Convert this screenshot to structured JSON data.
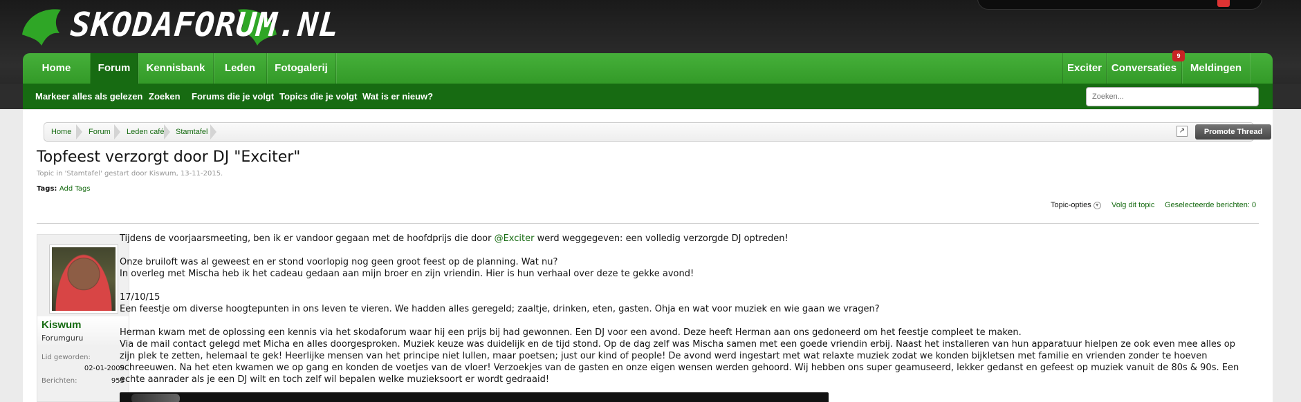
{
  "site": {
    "logo_text": "SKODAFORUM.NL"
  },
  "nav": {
    "tabs": [
      "Home",
      "Forum",
      "Kennisbank",
      "Leden",
      "Fotogalerij"
    ],
    "right_tabs": [
      "Exciter",
      "Conversaties",
      "Meldingen"
    ],
    "conversations_badge": "9",
    "sub_links": [
      "Markeer alles als gelezen",
      "Zoeken",
      "Forums die je volgt",
      "Topics die je volgt",
      "Wat is er nieuw?"
    ],
    "search_placeholder": "Zoeken..."
  },
  "breadcrumb": [
    "Home",
    "Forum",
    "Leden café",
    "Stamtafel"
  ],
  "promote_label": "Promote Thread",
  "thread": {
    "title": "Topfeest verzorgt door DJ \"Exciter\"",
    "meta": "Topic in 'Stamtafel' gestart door Kiswum, 13-11-2015.",
    "tags_label": "Tags:",
    "add_tags": "Add Tags"
  },
  "tools": {
    "options": "Topic-opties",
    "follow": "Volg dit topic",
    "selected": "Geselecteerde berichten: 0"
  },
  "user": {
    "name": "Kiswum",
    "title": "Forumguru",
    "joined_label": "Lid geworden:",
    "joined_value": "02-01-2009",
    "posts_label": "Berichten:",
    "posts_value": "953"
  },
  "post": {
    "p1_pre": "Tijdens de voorjaarsmeeting, ben ik er vandoor gegaan met de hoofdprijs die door ",
    "p1_mention": "@Exciter",
    "p1_post": " werd weggegeven: een volledig verzorgde DJ optreden!",
    "p2_line1": "Onze bruiloft was al geweest en er stond voorlopig nog geen groot feest op de planning. Wat nu?",
    "p2_line2": "In overleg met Mischa heb ik het cadeau gedaan aan mijn broer en zijn vriendin. Hier is hun verhaal over deze te gekke avond!",
    "p3_line1": "17/10/15",
    "p3_line2": "Een feestje om diverse hoogtepunten in ons leven te vieren. We hadden alles geregeld; zaaltje, drinken, eten, gasten. Ohja en wat voor muziek en wie gaan we vragen?",
    "p4_line1": "Herman kwam met de oplossing een kennis via het skodaforum waar hij een prijs bij had gewonnen. Een DJ voor een avond. Deze heeft Herman aan ons gedoneerd om het feestje compleet te maken.",
    "p4_line2": "Via de mail contact gelegd met Micha en alles doorgesproken. Muziek keuze was duidelijk en de tijd stond. Op de dag zelf was Mischa samen met een goede vriendin erbij. Naast het installeren van hun apparatuur hielpen ze ook even mee alles op zijn plek te zetten, helemaal te gek! Heerlijke mensen van het principe niet lullen, maar poetsen; just our kind of people! De avond werd ingestart met wat relaxte muziek zodat we konden bijkletsen met familie en vrienden zonder te hoeven schreeuwen. Na het eten kwamen we op gang en konden de voetjes van de vloer! Verzoekjes van de gasten en onze eigen wensen werden gehoord. Wij hebben ons super geamuseerd, lekker gedanst en gefeest op muziek vanuit de 80s & 90s. Een echte aanrader als je een DJ wilt en toch zelf wil bepalen welke muzieksoort er wordt gedraaid!"
  }
}
